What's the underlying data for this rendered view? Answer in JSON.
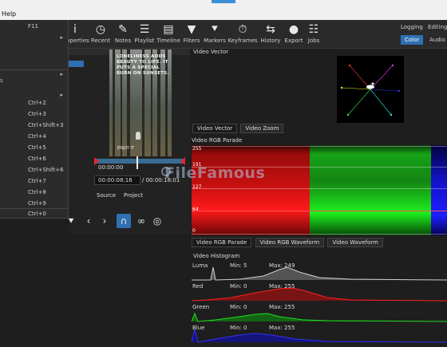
{
  "menubar": {
    "help": "Help"
  },
  "toolbar": {
    "tools": [
      {
        "label": "Properties",
        "icon": "info-icon",
        "glyph": "i"
      },
      {
        "label": "Recent",
        "icon": "clock-icon",
        "glyph": "◷"
      },
      {
        "label": "Notes",
        "icon": "notes-icon",
        "glyph": "✎"
      },
      {
        "label": "Playlist",
        "icon": "playlist-icon",
        "glyph": "☰"
      },
      {
        "label": "Timeline",
        "icon": "timeline-icon",
        "glyph": "▤"
      },
      {
        "label": "Filters",
        "icon": "filter-icon",
        "glyph": "▼"
      },
      {
        "label": "Markers",
        "icon": "marker-icon",
        "glyph": "⯆"
      },
      {
        "label": "Keyframes",
        "icon": "stopwatch-icon",
        "glyph": "⏱"
      },
      {
        "label": "History",
        "icon": "history-icon",
        "glyph": "⇆"
      },
      {
        "label": "Export",
        "icon": "export-icon",
        "glyph": "●"
      },
      {
        "label": "Jobs",
        "icon": "jobs-icon",
        "glyph": "☷"
      }
    ],
    "layout_tabs": [
      {
        "label": "Logging"
      },
      {
        "label": "Editing"
      },
      {
        "label": "Color"
      },
      {
        "label": "Audio"
      }
    ]
  },
  "dropdown": {
    "first_shortcut": "F11",
    "items": [
      "Ctrl+2",
      "Ctrl+3",
      "Ctrl+Shift+3",
      "Ctrl+4",
      "Ctrl+5",
      "Ctrl+6",
      "Ctrl+Shift+6",
      "Ctrl+7",
      "Ctrl+8",
      "Ctrl+9",
      "Ctrl+0"
    ],
    "side_letter": "s"
  },
  "player": {
    "overlay_text": "LONELINESS ADDS BEAUTY TO LIFE. IT PUTS A SPECIAL BURN ON SUNSETS.",
    "overlay_sign": "ENJOY IT",
    "timecode_scale": "00:00:00",
    "timecode_current": "00:00:08:16",
    "timecode_total": "/ 00:00:18:01",
    "source_tab": "Source",
    "project_tab": "Project"
  },
  "vector": {
    "title": "Video Vector",
    "tabs": [
      "Video Vector",
      "Video Zoom"
    ]
  },
  "parade": {
    "title": "Video RGB Parade",
    "levels": [
      "255",
      "191",
      "127",
      "64",
      "0"
    ],
    "tabs": [
      "Video RGB Parade",
      "Video RGB Waveform",
      "Video Waveform"
    ]
  },
  "histogram": {
    "title": "Video Histogram",
    "rows": [
      {
        "name": "Luma",
        "min": "Min: 5",
        "max": "Max: 249",
        "color": "#bdbdbd"
      },
      {
        "name": "Red",
        "min": "Min: 0",
        "max": "Max: 255",
        "color": "#e01818"
      },
      {
        "name": "Green",
        "min": "Min: 0",
        "max": "Max: 255",
        "color": "#18c018"
      },
      {
        "name": "Blue",
        "min": "Min: 0",
        "max": "Max: 255",
        "color": "#2a2aff"
      }
    ]
  },
  "watermark": "FileFamous"
}
